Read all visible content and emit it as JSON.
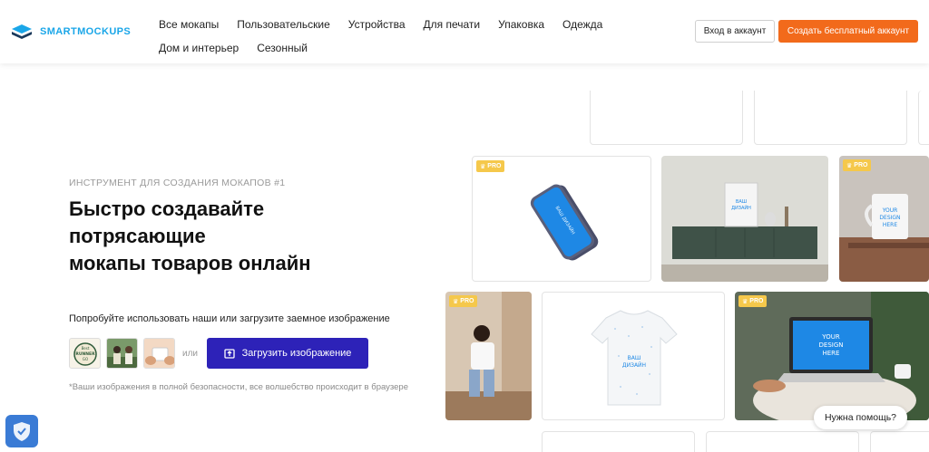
{
  "brand": {
    "name": "SMARTMOCKUPS",
    "accent": "#1aa6e8"
  },
  "nav": {
    "row1": [
      "Все мокапы",
      "Пользовательские",
      "Устройства",
      "Для печати",
      "Упаковка",
      "Одежда"
    ],
    "row2": [
      "Дом и интерьер",
      "Сезонный"
    ]
  },
  "header": {
    "login_label": "Вход в аккаунт",
    "signup_label": "Создать бесплатный аккаунт"
  },
  "hero": {
    "eyebrow": "ИНСТРУМЕНТ ДЛЯ СОЗДАНИЯ МОКАПОВ #1",
    "headline": [
      "Быстро создавайте",
      "потрясающие",
      "мокапы товаров онлайн"
    ],
    "try_text": "Попробуйте использовать наши или загрузите заемное изображение",
    "or_text": "или",
    "upload_label": "Загрузить изображение",
    "note": "*Ваши изображения в полной безопасности, все волшебство происходит в браузере",
    "sample_badge": [
      "Best",
      "RUNNER",
      "GO"
    ]
  },
  "cards": {
    "pro_label": "PRO",
    "phone_screen": "ВАШ ДИЗАЙН",
    "frame_text": [
      "ВАШ",
      "ДИЗАЙН"
    ],
    "mug_text": [
      "YOUR",
      "DESIGN",
      "HERE"
    ],
    "tshirt_text": [
      "ВАШ",
      "ДИЗАЙН"
    ],
    "laptop_text": [
      "YOUR",
      "DESIGN",
      "HERE"
    ]
  },
  "help": {
    "label": "Нужна помощь?"
  },
  "colors": {
    "signup": "#f26a1b",
    "upload": "#2d22b8",
    "pro": "#f5c84b",
    "screen": "#1e88e5"
  }
}
